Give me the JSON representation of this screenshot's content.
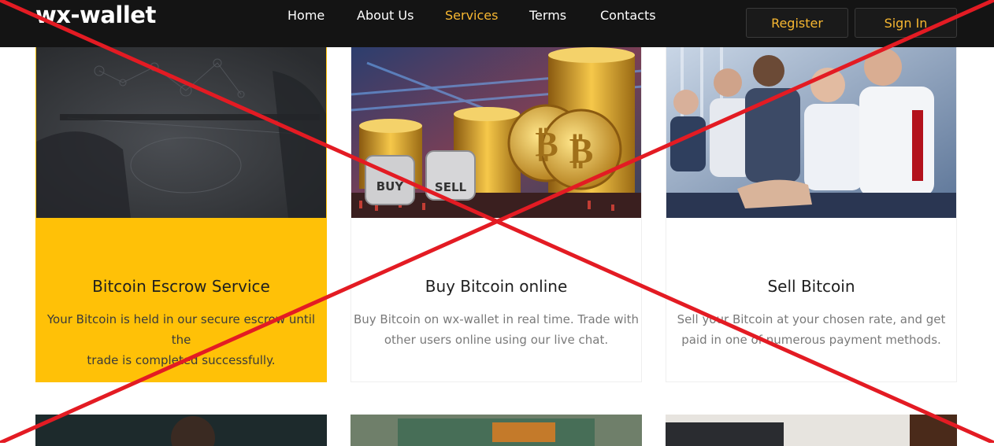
{
  "header": {
    "logo": "wx-wallet",
    "nav": [
      "Home",
      "About Us",
      "Services",
      "Terms",
      "Contacts"
    ],
    "active_nav": "Services",
    "register_label": "Register",
    "signin_label": "Sign In"
  },
  "cards": [
    {
      "title": "Bitcoin Escrow Service",
      "desc_line1": "Your Bitcoin is held in our secure escrow until the",
      "desc_line2": "trade is completed successfully."
    },
    {
      "title": "Buy Bitcoin online",
      "desc_line1": "Buy Bitcoin on wx-wallet in real time. Trade with",
      "desc_line2": "other users online using our live chat.",
      "dice": [
        "BUY",
        "SELL"
      ]
    },
    {
      "title": "Sell Bitcoin",
      "desc_line1": "Sell your Bitcoin at your chosen rate, and get",
      "desc_line2": "paid in one of numerous payment methods."
    }
  ],
  "colors": {
    "header_bg": "#141414",
    "accent": "#f7b731",
    "highlight_card": "#ffc107",
    "cross_lines": "#e31b23"
  }
}
